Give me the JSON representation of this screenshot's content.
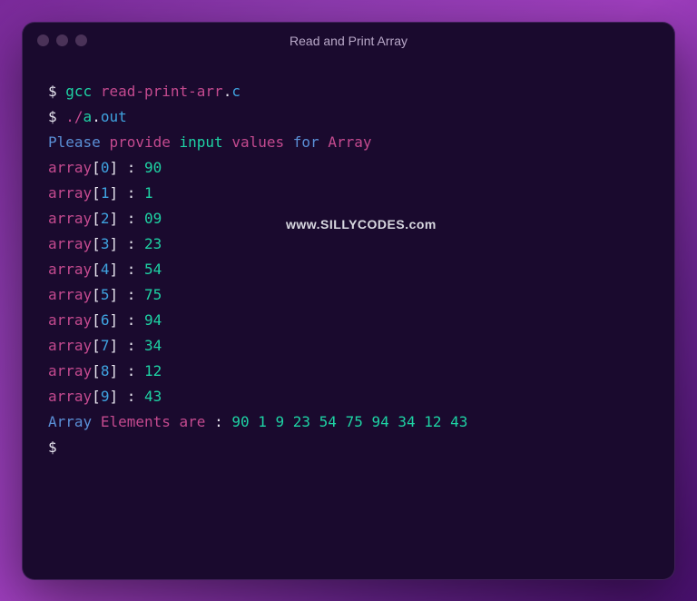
{
  "window": {
    "title": "Read and Print Array"
  },
  "terminal": {
    "prompt": "$",
    "cmd1_gcc": "gcc",
    "cmd1_file": "read-print-arr",
    "cmd1_dot": ".",
    "cmd1_ext": "c",
    "cmd2_slash": "./",
    "cmd2_a": "a",
    "cmd2_dot": ".",
    "cmd2_out": "out",
    "msg_please": "Please",
    "msg_provide": "provide",
    "msg_input": "input",
    "msg_values": "values",
    "msg_for": "for",
    "msg_array": "Array",
    "array_label": "array",
    "entries": [
      {
        "index": "0",
        "value": "90"
      },
      {
        "index": "1",
        "value": "1"
      },
      {
        "index": "2",
        "value": "09"
      },
      {
        "index": "3",
        "value": "23"
      },
      {
        "index": "4",
        "value": "54"
      },
      {
        "index": "5",
        "value": "75"
      },
      {
        "index": "6",
        "value": "94"
      },
      {
        "index": "7",
        "value": "34"
      },
      {
        "index": "8",
        "value": "12"
      },
      {
        "index": "9",
        "value": "43"
      }
    ],
    "out_array": "Array",
    "out_elements": "Elements",
    "out_are": "are",
    "out_colon": ":",
    "out_values": "90 1 9 23 54 75 94 34 12 43"
  },
  "watermark": "www.SILLYCODES.com"
}
